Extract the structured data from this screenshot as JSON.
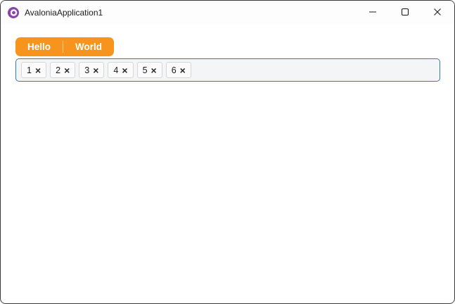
{
  "colors": {
    "accent_orange": "#F7941D",
    "tags_border_blue": "#2F7BAE",
    "tags_background": "#F3F5F6",
    "logo_purple": "#8B44AC",
    "window_border": "#3B3B3B",
    "chip_background": "#FBFBFB",
    "chip_border": "#D6D6D6",
    "text_dark": "#1A1A1A"
  },
  "titlebar": {
    "title": "AvaloniaApplication1"
  },
  "icons": {
    "logo": "avalonia-logo",
    "minimize": "minimize-line",
    "maximize": "maximize-square",
    "close": "close-x",
    "chip_remove": "×"
  },
  "toolbar": {
    "items": [
      {
        "label": "Hello"
      },
      {
        "label": "World"
      }
    ]
  },
  "chips": {
    "items": [
      {
        "label": "1"
      },
      {
        "label": "2"
      },
      {
        "label": "3"
      },
      {
        "label": "4"
      },
      {
        "label": "5"
      },
      {
        "label": "6"
      }
    ],
    "remove_icon": "×"
  }
}
